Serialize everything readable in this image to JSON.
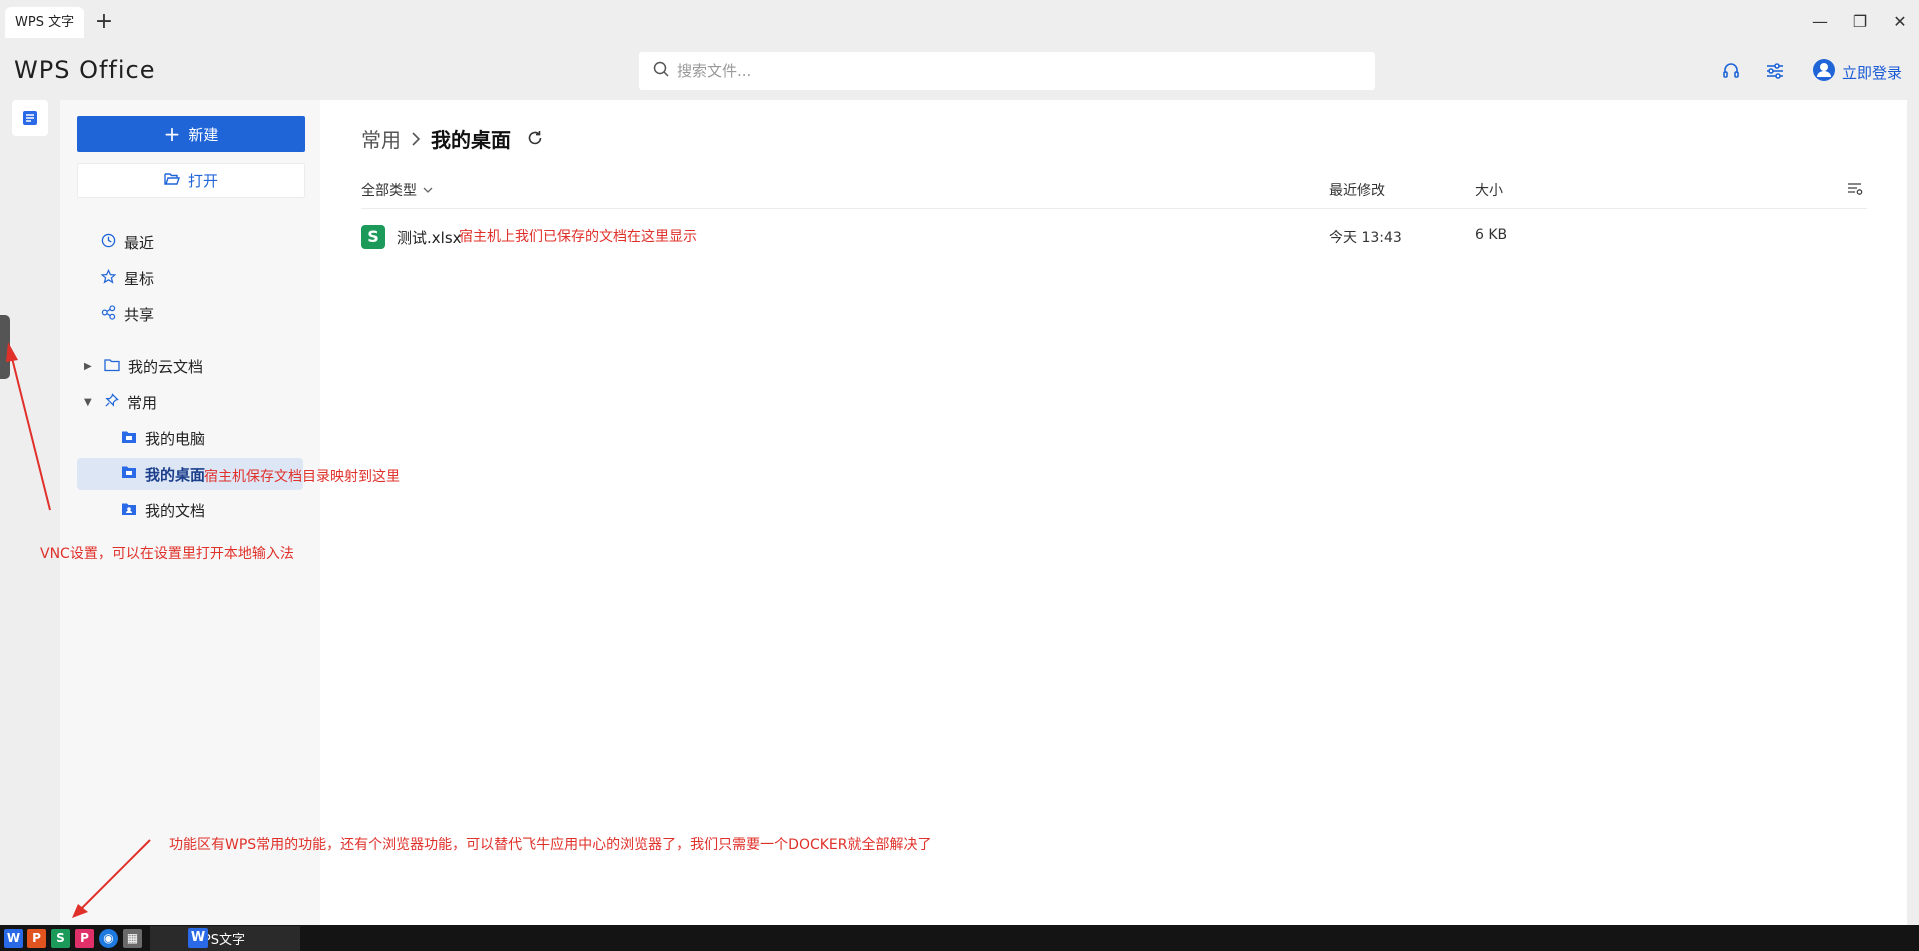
{
  "titlebar": {
    "tab_label": "WPS 文字",
    "add_tab": "+",
    "minimize": "—",
    "restore": "❐",
    "close": "✕"
  },
  "header": {
    "logo": "WPS Office",
    "search_placeholder": "搜索文件...",
    "login_label": "立即登录"
  },
  "sidebar": {
    "new_label": "新建",
    "open_label": "打开",
    "items": [
      {
        "label": "最近"
      },
      {
        "label": "星标"
      },
      {
        "label": "共享"
      },
      {
        "label": "我的云文档"
      },
      {
        "label": "常用"
      },
      {
        "label": "我的电脑"
      },
      {
        "label": "我的桌面"
      },
      {
        "label": "我的文档"
      }
    ]
  },
  "main": {
    "breadcrumb_root": "常用",
    "breadcrumb_current": "我的桌面",
    "columns": {
      "type": "全部类型",
      "modified": "最近修改",
      "size": "大小"
    },
    "files": [
      {
        "name": "测试.xlsx",
        "modified": "今天 13:43",
        "size": "6 KB",
        "icon_letter": "S"
      }
    ]
  },
  "annotations": {
    "file_note": "宿主机上我们已保存的文档在这里显示",
    "desktop_note": "宿主机保存文档目录映射到这里",
    "vnc_note": "VNC设置，可以在设置里打开本地输入法",
    "taskbar_note": "功能区有WPS常用的功能，还有个浏览器功能，可以替代飞牛应用中心的浏览器了，我们只需要一个DOCKER就全部解决了"
  },
  "taskbar": {
    "icons": [
      {
        "letter": "W",
        "color": "#2b6ae6"
      },
      {
        "letter": "P",
        "color": "#e2541f"
      },
      {
        "letter": "S",
        "color": "#1b9a5a"
      },
      {
        "letter": "P",
        "color": "#e0306a"
      },
      {
        "letter": "◉",
        "color": "#1f7ae0"
      },
      {
        "letter": "▦",
        "color": "#6a6a6a"
      }
    ],
    "window_label": "WPS文字",
    "window_icon_letter": "W"
  },
  "colors": {
    "accent": "#1f65d8",
    "annotation": "#e0302a",
    "xlsx": "#1b9a5a"
  }
}
